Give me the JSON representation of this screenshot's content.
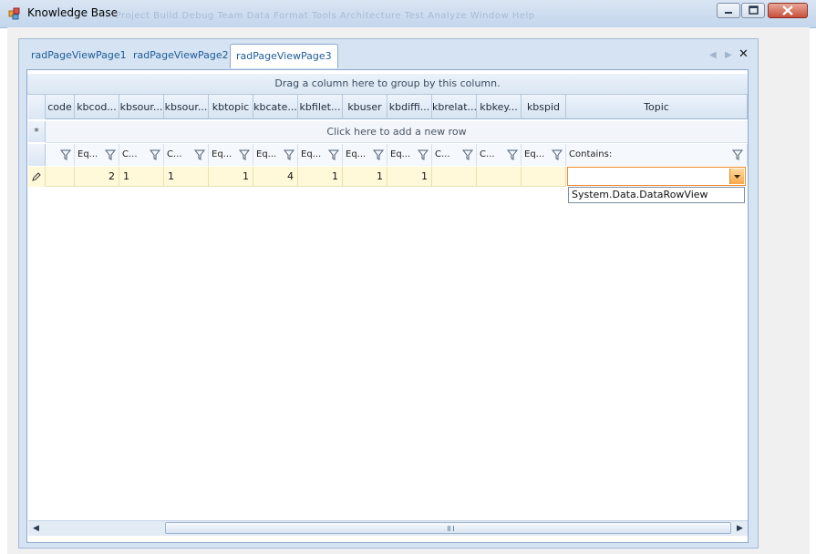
{
  "window": {
    "title": "Knowledge Base",
    "faded_menu": "...  Project  Build  Debug  Team  Data  Format  Tools  Architecture  Test  Analyze  Window  Help"
  },
  "tabs": [
    {
      "label": "radPageViewPage1",
      "active": false
    },
    {
      "label": "radPageViewPage2",
      "active": false
    },
    {
      "label": "radPageViewPage3",
      "active": true
    }
  ],
  "grid": {
    "group_panel_text": "Drag a column here to group by this column.",
    "new_row_text": "Click here to add a new row",
    "new_row_indicator": "*",
    "columns": [
      {
        "header": "code",
        "filter_op": "",
        "value": ""
      },
      {
        "header": "kbcod...",
        "filter_op": "Eq...",
        "value": "2"
      },
      {
        "header": "kbsour...",
        "filter_op": "C...",
        "value": "1"
      },
      {
        "header": "kbsour...",
        "filter_op": "C...",
        "value": "1"
      },
      {
        "header": "kbtopic",
        "filter_op": "Eq...",
        "value": "1"
      },
      {
        "header": "kbcate...",
        "filter_op": "Eq...",
        "value": "4"
      },
      {
        "header": "kbfilet...",
        "filter_op": "Eq...",
        "value": "1"
      },
      {
        "header": "kbuser",
        "filter_op": "Eq...",
        "value": "1"
      },
      {
        "header": "kbdiffi...",
        "filter_op": "Eq...",
        "value": "1"
      },
      {
        "header": "kbrelat...",
        "filter_op": "C...",
        "value": ""
      },
      {
        "header": "kbkey...",
        "filter_op": "C...",
        "value": ""
      },
      {
        "header": "kbspid",
        "filter_op": "Eq...",
        "value": ""
      },
      {
        "header": "Topic",
        "filter_op": "Contains:",
        "value": ""
      }
    ],
    "edit_dropdown_item": "System.Data.DataRowView"
  },
  "colors": {
    "accent": "#f08a24",
    "selected_row": "#fff9d9",
    "tab_text": "#1f5c9a"
  }
}
